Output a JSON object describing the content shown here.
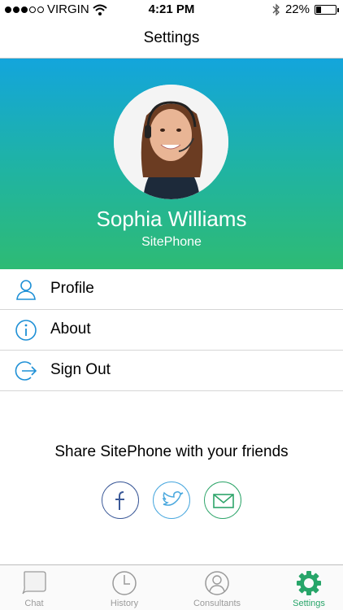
{
  "status_bar": {
    "carrier": "VIRGIN",
    "time": "4:21 PM",
    "battery_percent": "22%",
    "battery_level": 0.22,
    "signal_bars_filled": 3,
    "signal_bars_total": 5,
    "icons": [
      "wifi-icon",
      "bluetooth-icon",
      "battery-icon"
    ]
  },
  "nav": {
    "title": "Settings"
  },
  "profile": {
    "name": "Sophia Williams",
    "company": "SitePhone",
    "gradient_colors": [
      "#13a5dc",
      "#2ebb74"
    ]
  },
  "menu": {
    "items": [
      {
        "label": "Profile",
        "icon": "user-icon"
      },
      {
        "label": "About",
        "icon": "info-icon"
      },
      {
        "label": "Sign Out",
        "icon": "sign-out-icon"
      }
    ],
    "icon_color": "#1e90d6"
  },
  "share": {
    "text": "Share SitePhone with your friends",
    "buttons": [
      {
        "name": "facebook",
        "color": "#3b5998"
      },
      {
        "name": "twitter",
        "color": "#4aa8de"
      },
      {
        "name": "email",
        "color": "#2ea56a"
      }
    ]
  },
  "tabs": [
    {
      "label": "Chat",
      "icon": "chat-bubble-icon",
      "active": false
    },
    {
      "label": "History",
      "icon": "clock-icon",
      "active": false
    },
    {
      "label": "Consultants",
      "icon": "person-icon",
      "active": false
    },
    {
      "label": "Settings",
      "icon": "gear-icon",
      "active": true
    }
  ],
  "colors": {
    "active_tab": "#27a569",
    "inactive_tab": "#9a9a9a"
  }
}
